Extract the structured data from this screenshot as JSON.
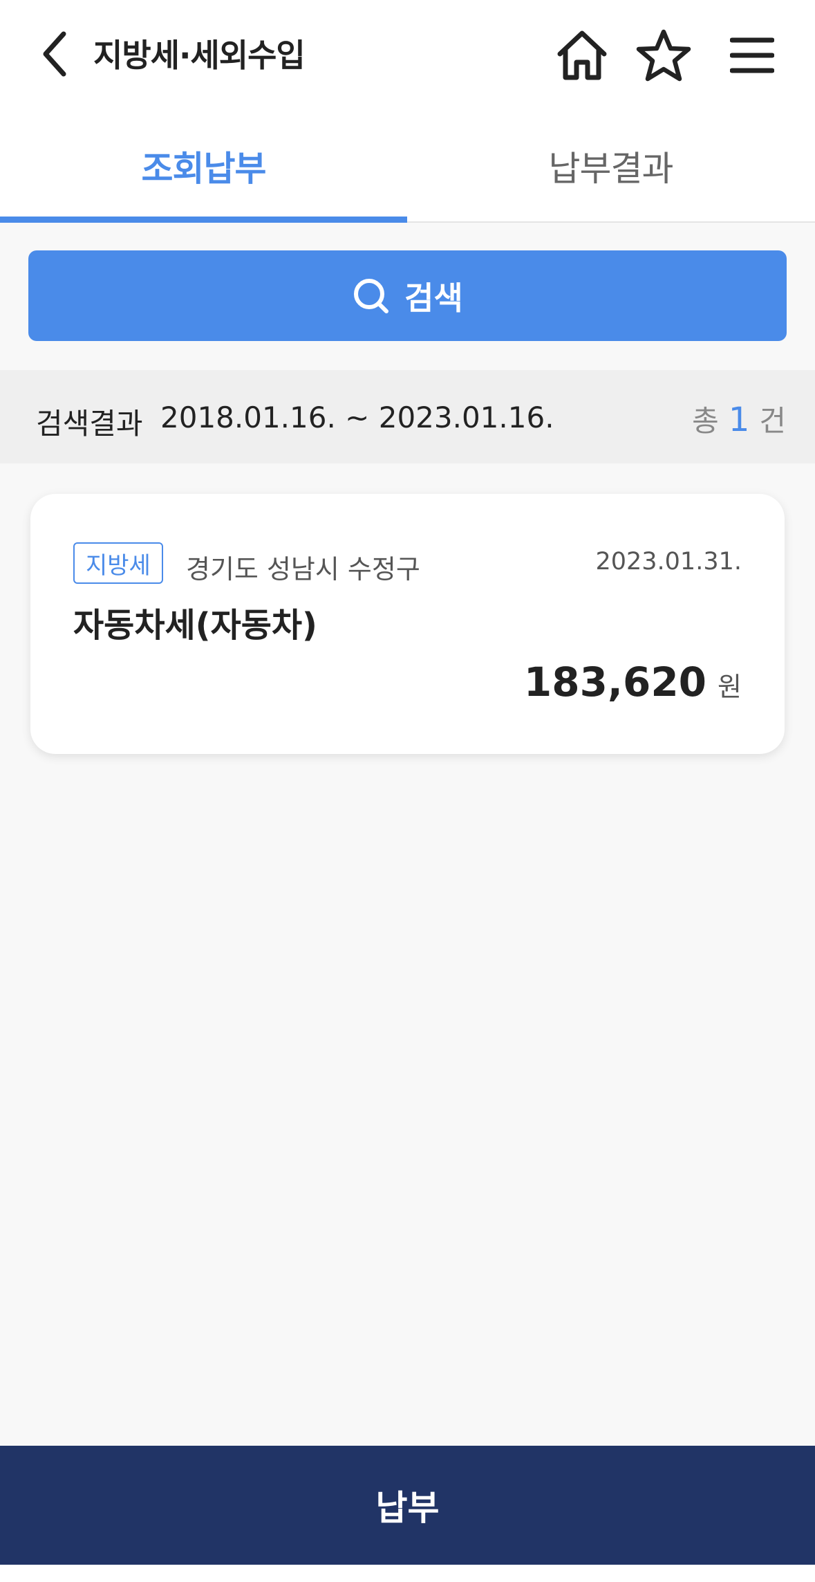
{
  "header": {
    "title": "지방세·세외수입",
    "icons": {
      "back": "chevron-left-icon",
      "home": "home-icon",
      "favorite": "star-icon",
      "menu": "hamburger-menu-icon"
    }
  },
  "tabs": [
    {
      "label": "조회납부",
      "active": true
    },
    {
      "label": "납부결과",
      "active": false
    }
  ],
  "search": {
    "label": "검색",
    "icon": "search-icon"
  },
  "results": {
    "label": "검색결과",
    "range": "2018.01.16. ~ 2023.01.16.",
    "count_prefix": "총",
    "count": "1",
    "count_suffix": "건"
  },
  "tax_items": [
    {
      "type": "지방세",
      "region": "경기도 성남시 수정구",
      "due_date": "2023.01.31.",
      "name": "자동차세(자동차)",
      "amount": "183,620",
      "currency": "원"
    }
  ],
  "footer": {
    "pay_label": "납부"
  },
  "colors": {
    "accent": "#4a8be9",
    "primary_dark": "#213466",
    "background": "#f8f8f8"
  }
}
